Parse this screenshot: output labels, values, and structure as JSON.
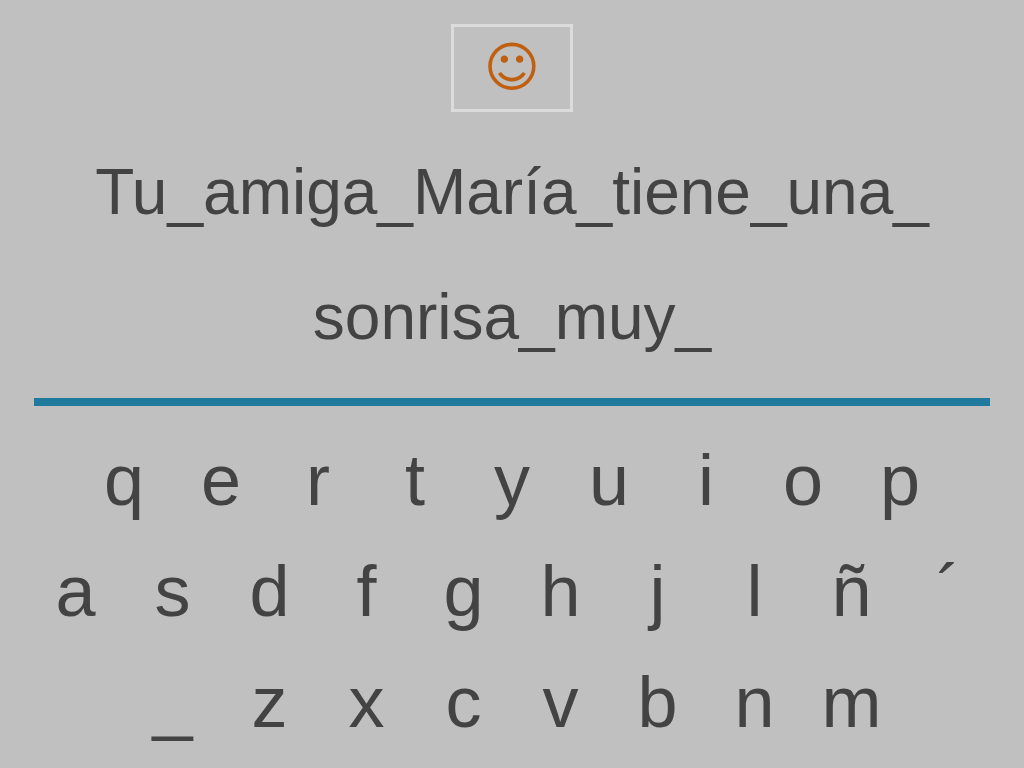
{
  "hint_button": {
    "symbol": "☺"
  },
  "sentence_lines": [
    "Tu_amiga_María_tiene_una_",
    "sonrisa_muy_"
  ],
  "keyboard_rows": [
    [
      "q",
      "e",
      "r",
      "t",
      "y",
      "u",
      "i",
      "o",
      "p"
    ],
    [
      "a",
      "s",
      "d",
      "f",
      "g",
      "h",
      "j",
      "l",
      "ñ",
      "´"
    ],
    [
      "_",
      "z",
      "x",
      "c",
      "v",
      "b",
      "n",
      "m"
    ]
  ]
}
